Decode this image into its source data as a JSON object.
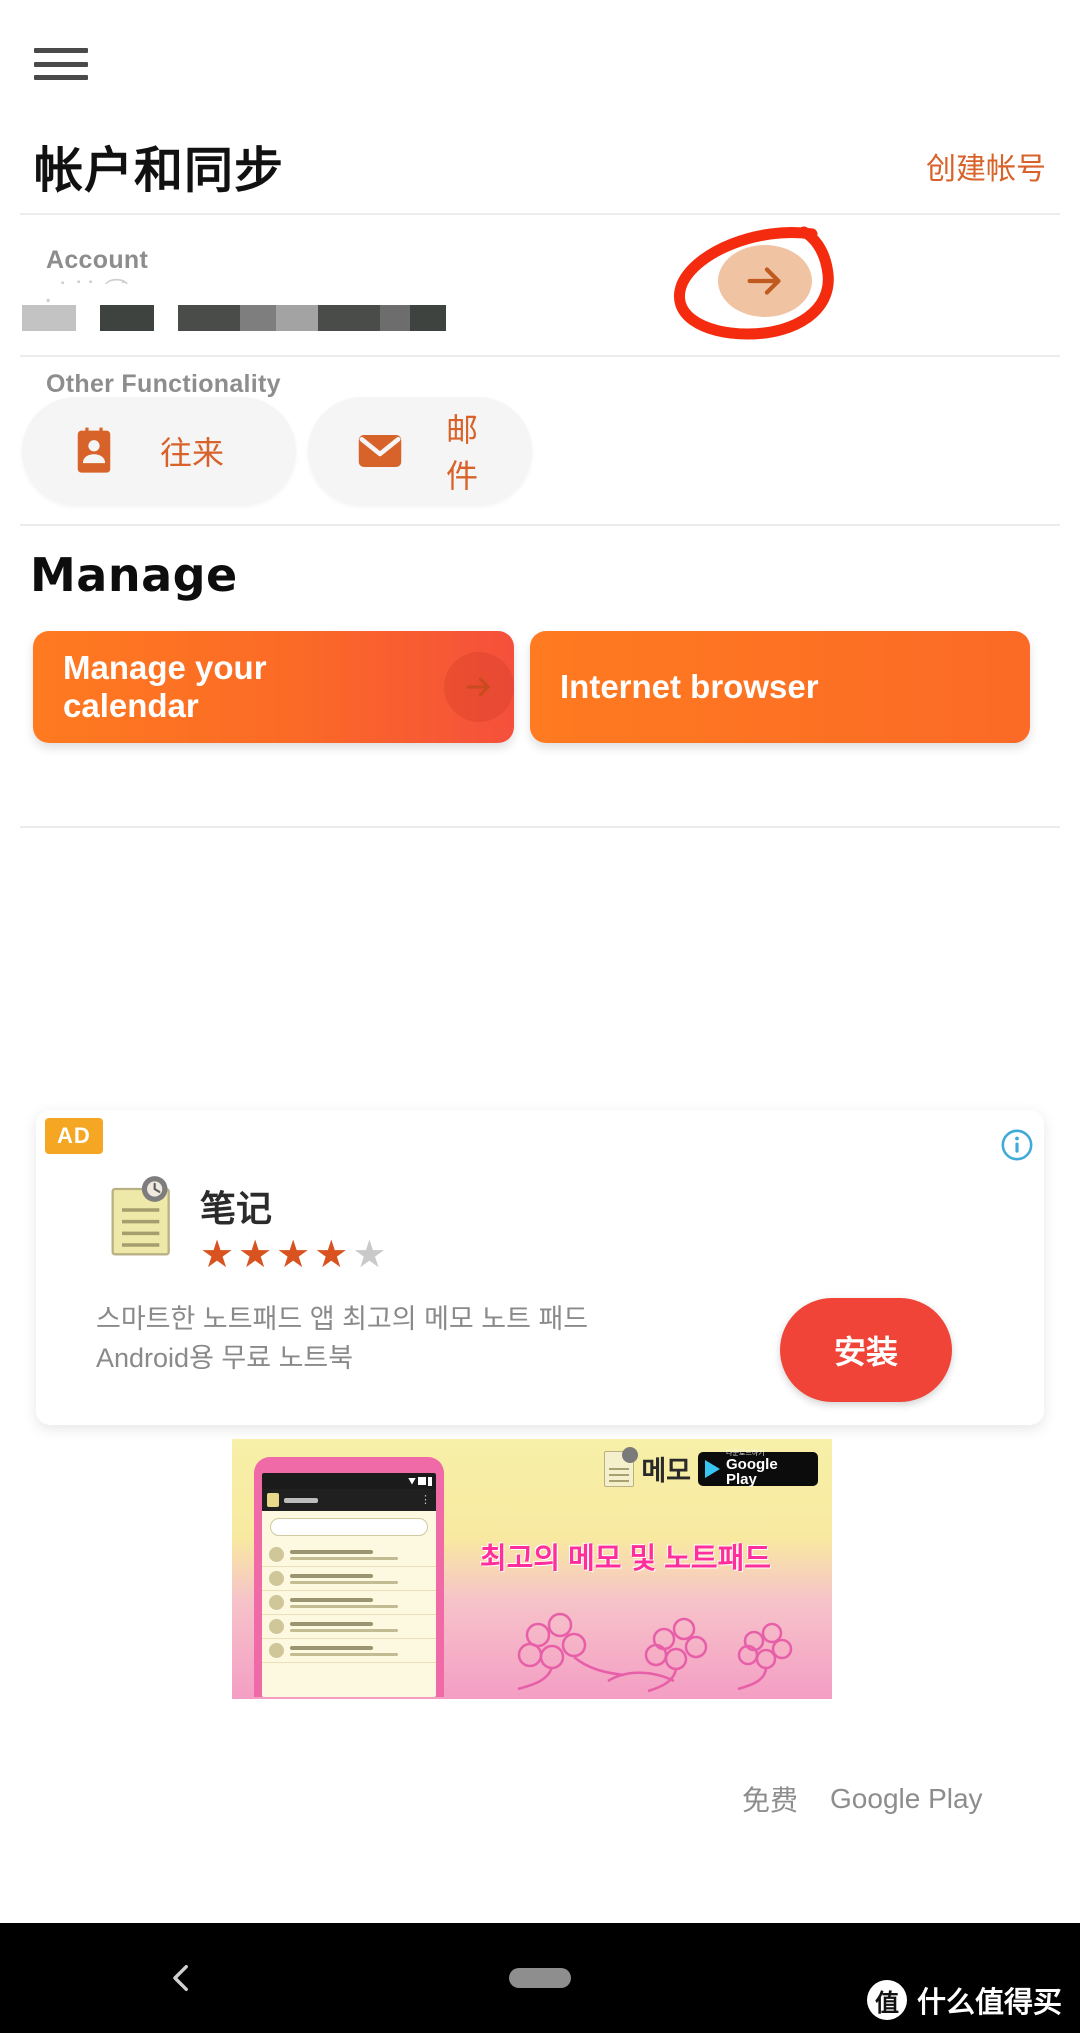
{
  "header": {
    "menu_icon": "hamburger-menu-icon",
    "title": "帐户和同步",
    "create_account_link": "创建帐号"
  },
  "account": {
    "label": "Account",
    "redacted_value": "",
    "arrow_icon": "arrow-right-icon",
    "annotation": "red-circle-highlight"
  },
  "other_functionality": {
    "label": "Other Functionality",
    "buttons": [
      {
        "label": "往来",
        "icon": "contact-card-icon"
      },
      {
        "label": "邮件",
        "icon": "envelope-icon"
      }
    ]
  },
  "manage": {
    "heading": "Manage",
    "cards": [
      {
        "label": "Manage your calendar",
        "icon": "arrow-right-icon"
      },
      {
        "label": "Internet browser",
        "icon": ""
      }
    ]
  },
  "ad": {
    "badge": "AD",
    "info_icon": "info-circle-icon",
    "app_icon": "notepad-icon",
    "app_title": "笔记",
    "rating": 4,
    "rating_max": 5,
    "description": "스마트한 노트패드 앱 최고의 메모 노트 패드\nAndroid용 무료 노트북",
    "install_label": "安装",
    "banner": {
      "logo_text": "메모",
      "store_badge_title": "Google Play",
      "store_badge_sub": "다운로드하기",
      "headline": "최고의 메모 및 노트패드"
    },
    "footer": {
      "price": "免费",
      "store": "Google Play"
    }
  },
  "navbar": {
    "back_icon": "chevron-left-icon",
    "home_icon": "home-pill-icon",
    "watermark_badge": "值",
    "watermark_text": "什么值得买"
  },
  "colors": {
    "accent_orange": "#d8632a",
    "card_orange_start": "#ff7a20",
    "card_orange_end": "#f5503c",
    "install_red": "#f04438",
    "ad_badge_yellow": "#f5a623",
    "scribble_red": "#f42b0e",
    "star_active": "#d8531f",
    "star_inactive": "#c9c9c9"
  }
}
